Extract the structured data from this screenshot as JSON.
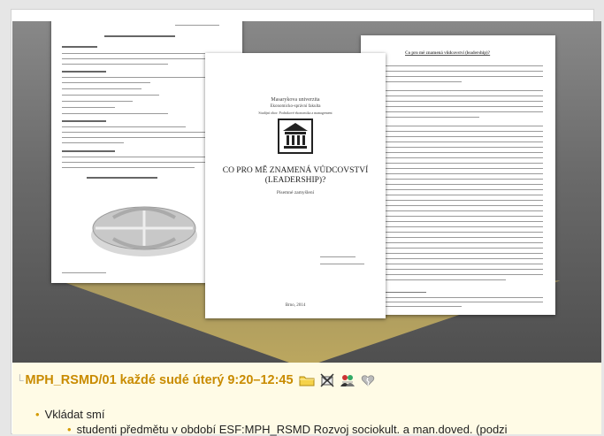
{
  "course": {
    "title": "MPH_RSMD/01 každé sudé úterý 9:20–12:45"
  },
  "icons": [
    "folder-icon",
    "mail-blocked-icon",
    "group-icon",
    "broken-heart-icon"
  ],
  "bullets": [
    {
      "label": "Vkládat smí"
    }
  ],
  "sub_bullets": [
    {
      "label": "studenti předmětu v období ESF:MPH_RSMD Rozvoj sociokult. a man.doved. (podzi"
    }
  ],
  "document": {
    "page2_university": "Masarykova univerzita",
    "page2_faculty": "Ekonomicko-správní fakulta",
    "page2_department": "Studijní obor: Podnikové ekonomika a management",
    "page2_title": "CO PRO MĚ ZNAMENÁ VŮDCOVSTVÍ (LEADERSHIP)?",
    "page2_subtitle": "Písemné zamyšlení",
    "page2_city": "Brno, 2014",
    "page3_heading": "Co pro mě znamená vůdcovství (leadership)?"
  }
}
